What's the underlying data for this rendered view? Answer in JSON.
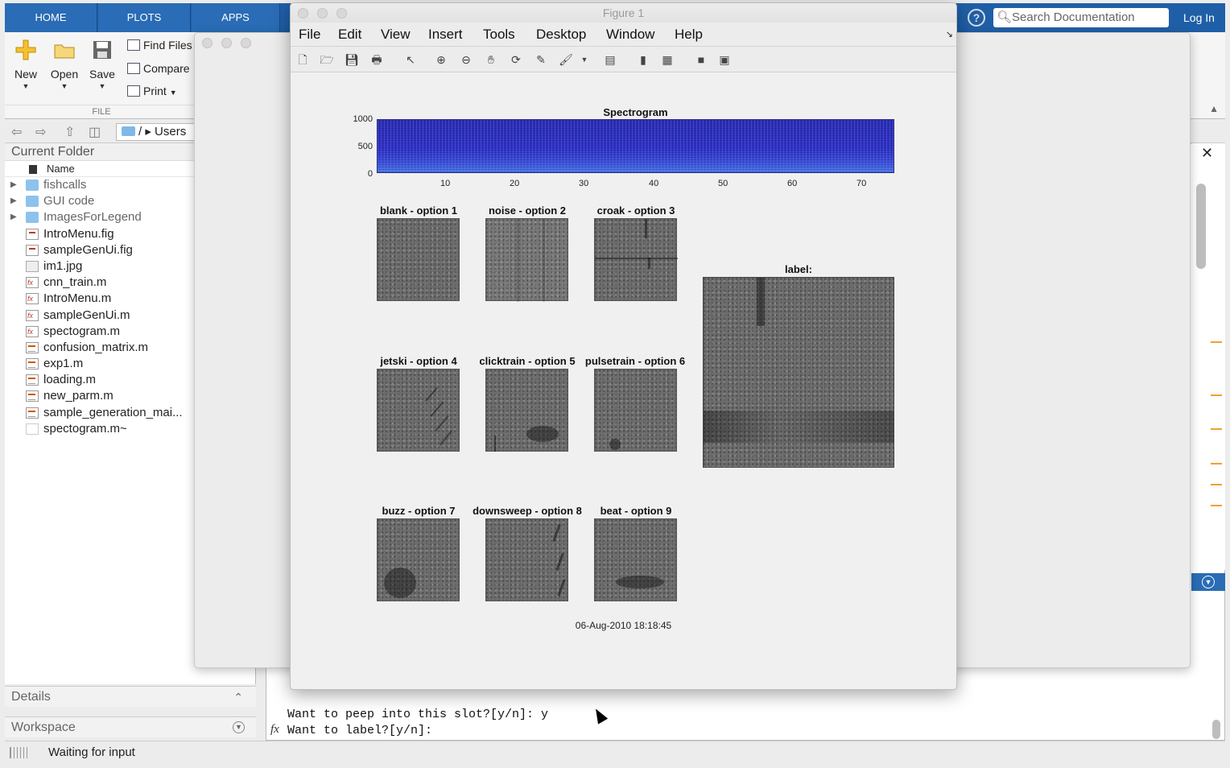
{
  "toolstrip": {
    "tabs": [
      "HOME",
      "PLOTS",
      "APPS"
    ],
    "search_placeholder": "Search Documentation",
    "login_label": "Log In",
    "help_label": "?"
  },
  "ribbon": {
    "new_label": "New",
    "open_label": "Open",
    "save_label": "Save",
    "find_files_label": "Find Files",
    "compare_label": "Compare",
    "print_label": "Print",
    "section_label": "FILE"
  },
  "address": {
    "path": "/ ▸ Users"
  },
  "current_folder": {
    "title": "Current Folder",
    "column_name": "Name",
    "items": [
      {
        "label": "fishcalls",
        "type": "folder"
      },
      {
        "label": "GUI code",
        "type": "folder"
      },
      {
        "label": "ImagesForLegend",
        "type": "folder"
      },
      {
        "label": "IntroMenu.fig",
        "type": "fig"
      },
      {
        "label": "sampleGenUi.fig",
        "type": "fig"
      },
      {
        "label": "im1.jpg",
        "type": "image"
      },
      {
        "label": "cnn_train.m",
        "type": "func"
      },
      {
        "label": "IntroMenu.m",
        "type": "func"
      },
      {
        "label": "sampleGenUi.m",
        "type": "func"
      },
      {
        "label": "spectogram.m",
        "type": "func"
      },
      {
        "label": "confusion_matrix.m",
        "type": "script"
      },
      {
        "label": "exp1.m",
        "type": "script"
      },
      {
        "label": "loading.m",
        "type": "script"
      },
      {
        "label": "new_parm.m",
        "type": "script"
      },
      {
        "label": "sample_generation_mai...",
        "type": "script"
      },
      {
        "label": "spectogram.m~",
        "type": "generic"
      }
    ]
  },
  "panels": {
    "details_label": "Details",
    "workspace_label": "Workspace"
  },
  "status": {
    "text": "Waiting for input"
  },
  "command_window": {
    "line1": "Want to peep into this slot?[y/n]: y",
    "line2": "Want to label?[y/n]:",
    "fx_symbol": "fx"
  },
  "figure_window": {
    "title": "Figure 1",
    "menus": [
      "File",
      "Edit",
      "View",
      "Insert",
      "Tools",
      "Desktop",
      "Window",
      "Help"
    ],
    "toolbar_icons": [
      "new-figure-icon",
      "open-file-icon",
      "save-icon",
      "print-icon",
      "pointer-icon",
      "zoom-in-icon",
      "zoom-out-icon",
      "pan-icon",
      "rotate-icon",
      "data-cursor-icon",
      "brush-icon",
      "link-icon",
      "colorbar-icon",
      "legend-icon",
      "hide-tools-icon",
      "show-tools-icon"
    ],
    "spectrogram": {
      "title": "Spectrogram",
      "y_ticks": [
        "1000",
        "500",
        "0"
      ],
      "x_ticks": [
        "10",
        "20",
        "30",
        "40",
        "50",
        "60",
        "70"
      ]
    },
    "options": [
      {
        "title": "blank - option 1"
      },
      {
        "title": "noise - option 2"
      },
      {
        "title": "croak - option 3"
      },
      {
        "title": "jetski - option 4"
      },
      {
        "title": "clicktrain - option 5"
      },
      {
        "title": "pulsetrain - option 6"
      },
      {
        "title": "buzz - option 7"
      },
      {
        "title": "downsweep - option 8"
      },
      {
        "title": "beat - option 9"
      }
    ],
    "label_title": "label:",
    "timestamp": "06-Aug-2010 18:18:45"
  }
}
